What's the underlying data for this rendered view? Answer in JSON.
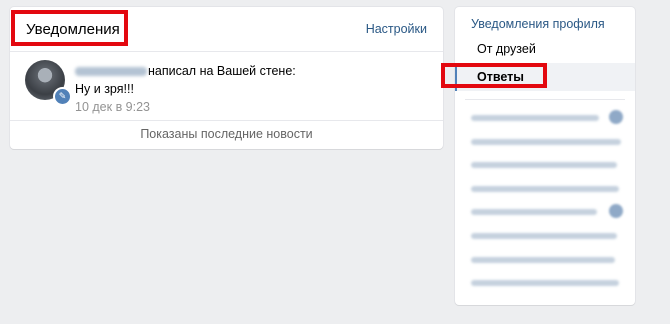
{
  "header": {
    "title": "Уведомления",
    "settings_label": "Настройки"
  },
  "notification": {
    "action_text": "написал на Вашей стене:",
    "message": "Ну и зря!!!",
    "time": "10 дек в 9:23",
    "badge_icon": "pencil-icon"
  },
  "footer": {
    "text": "Показаны последние новости"
  },
  "sidebar": {
    "title": "Уведомления профиля",
    "items": [
      {
        "label": "От друзей"
      },
      {
        "label": "Ответы",
        "active": true
      }
    ]
  },
  "colors": {
    "accent": "#5181b8",
    "link": "#2a5885",
    "highlight": "#e3080f",
    "background": "#edeef0"
  }
}
